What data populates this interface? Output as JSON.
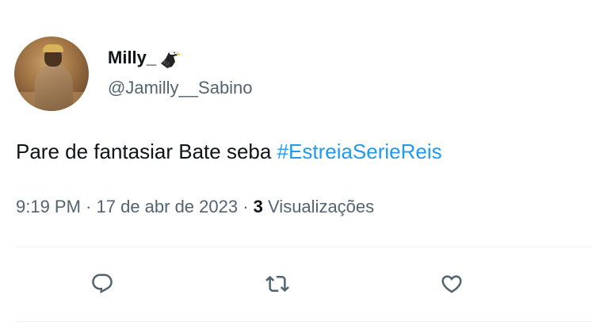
{
  "user": {
    "display_name": "Milly_",
    "name_emoji_icon": "eagle-icon",
    "handle": "@Jamilly__Sabino"
  },
  "tweet": {
    "text": "Pare de fantasiar Bate seba ",
    "hashtag": "#EstreiaSerieReis"
  },
  "meta": {
    "time": "9:19 PM",
    "separator1": " · ",
    "date": "17 de abr de 2023",
    "separator2": " · ",
    "views_count": "3",
    "views_label": " Visualizações"
  },
  "actions": {
    "reply_icon": "reply-icon",
    "retweet_icon": "retweet-icon",
    "like_icon": "like-icon"
  },
  "colors": {
    "text_primary": "#0f1419",
    "text_secondary": "#536471",
    "link": "#1d9bf0",
    "divider": "#eff3f4"
  }
}
